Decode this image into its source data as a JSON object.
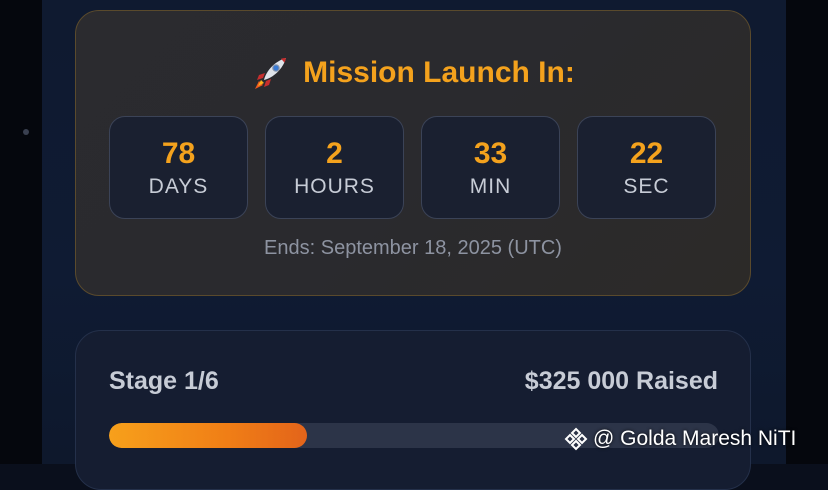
{
  "colors": {
    "accent": "#f4a21d",
    "progress_start": "#f7a01b",
    "progress_end": "#e3641a",
    "card_border": "#5a4a2c"
  },
  "countdown": {
    "icon": "rocket-icon",
    "title": "Mission Launch In:",
    "tiles": [
      {
        "value": "78",
        "unit": "DAYS"
      },
      {
        "value": "2",
        "unit": "HOURS"
      },
      {
        "value": "33",
        "unit": "MIN"
      },
      {
        "value": "22",
        "unit": "SEC"
      }
    ],
    "ends_text": "Ends: September 18, 2025 (UTC)"
  },
  "stage": {
    "label": "Stage 1/6",
    "raised": "$325 000 Raised",
    "progress_fraction": 0.325
  },
  "watermark": {
    "icon": "binance-logo-icon",
    "text": "@ Golda Maresh NiTI"
  }
}
